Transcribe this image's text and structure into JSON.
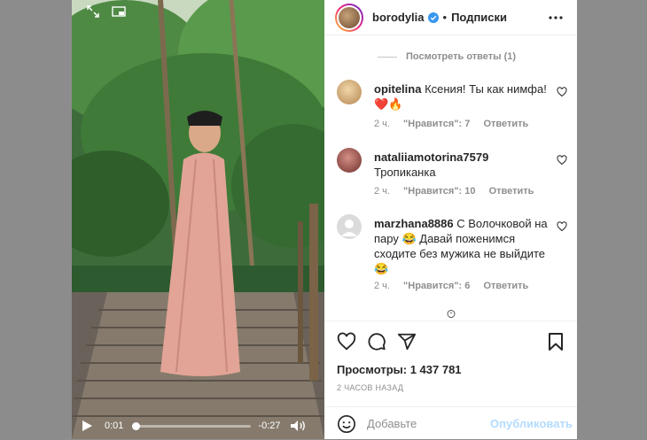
{
  "video": {
    "current_time": "0:01",
    "remaining_time": "-0:27",
    "progress_percent": 3
  },
  "post": {
    "username": "borodylia",
    "separator": "•",
    "follow_label": "Подписки"
  },
  "view_replies": "Посмотреть ответы (1)",
  "comments": [
    {
      "username": "opitelina",
      "text": "Ксения! Ты как нимфа! ❤️🔥",
      "time": "2 ч.",
      "likes": "\"Нравится\": 7",
      "reply": "Ответить"
    },
    {
      "username": "nataliiamotorina7579",
      "text": "Тропиканка",
      "time": "2 ч.",
      "likes": "\"Нравится\": 10",
      "reply": "Ответить"
    },
    {
      "username": "marzhana8886",
      "text": "С Волочковой на пару 😂 Давай поженимся сходите без мужика не выйдите 😂",
      "time": "2 ч.",
      "likes": "\"Нравится\": 6",
      "reply": "Ответить"
    }
  ],
  "stats": {
    "views": "Просмотры: 1 437 781",
    "time_ago": "2 ЧАСОВ НАЗАД"
  },
  "add_comment": {
    "placeholder": "Добавьте",
    "publish_label": "Опубликовать"
  },
  "colors": {
    "verified": "#3897f0",
    "publish_disabled": "#b3dbff",
    "meta_gray": "#8e8e8e"
  }
}
